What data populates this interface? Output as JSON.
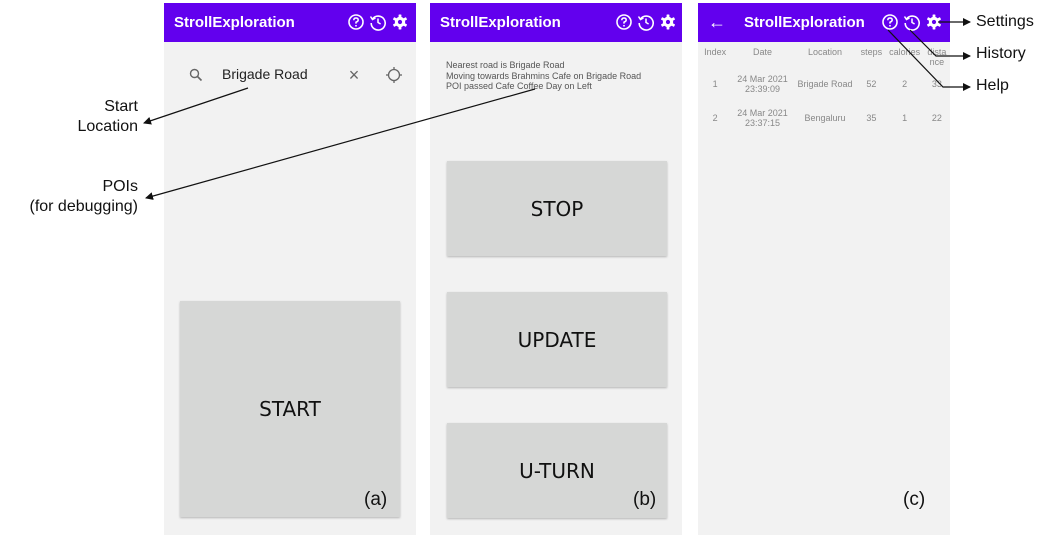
{
  "app": {
    "title": "StrollExploration"
  },
  "screen_a": {
    "search_value": "Brigade Road",
    "start_label": "START",
    "panel_label": "(a)"
  },
  "screen_b": {
    "debug_lines": [
      "Nearest road is Brigade Road",
      "Moving towards Brahmins Cafe on Brigade Road",
      "POI passed Cafe Coffee Day on Left"
    ],
    "stop_label": "STOP",
    "update_label": "UPDATE",
    "uturn_label": "U-TURN",
    "panel_label": "(b)"
  },
  "screen_c": {
    "columns": [
      "Index",
      "Date",
      "Location",
      "steps",
      "calories",
      "distance"
    ],
    "rows": [
      {
        "index": "1",
        "date_line1": "24 Mar 2021",
        "date_line2": "23:39:09",
        "location": "Brigade Road",
        "steps": "52",
        "calories": "2",
        "distance": "33"
      },
      {
        "index": "2",
        "date_line1": "24 Mar 2021",
        "date_line2": "23:37:15",
        "location": "Bengaluru",
        "steps": "35",
        "calories": "1",
        "distance": "22"
      }
    ],
    "panel_label": "(c)"
  },
  "annotations": {
    "start_location_line1": "Start",
    "start_location_line2": "Location",
    "pois_line1": "POIs",
    "pois_line2": "(for debugging)",
    "settings": "Settings",
    "history": "History",
    "help": "Help"
  },
  "icons": {
    "appbar": [
      "help-icon",
      "history-icon",
      "settings-icon"
    ],
    "search": [
      "search-icon",
      "close-icon",
      "locate-icon"
    ],
    "nav": [
      "back-arrow-icon"
    ]
  },
  "colors": {
    "appbar": "#6200ee",
    "button": "#d6d7d6",
    "screen_bg": "#f2f2f2"
  }
}
